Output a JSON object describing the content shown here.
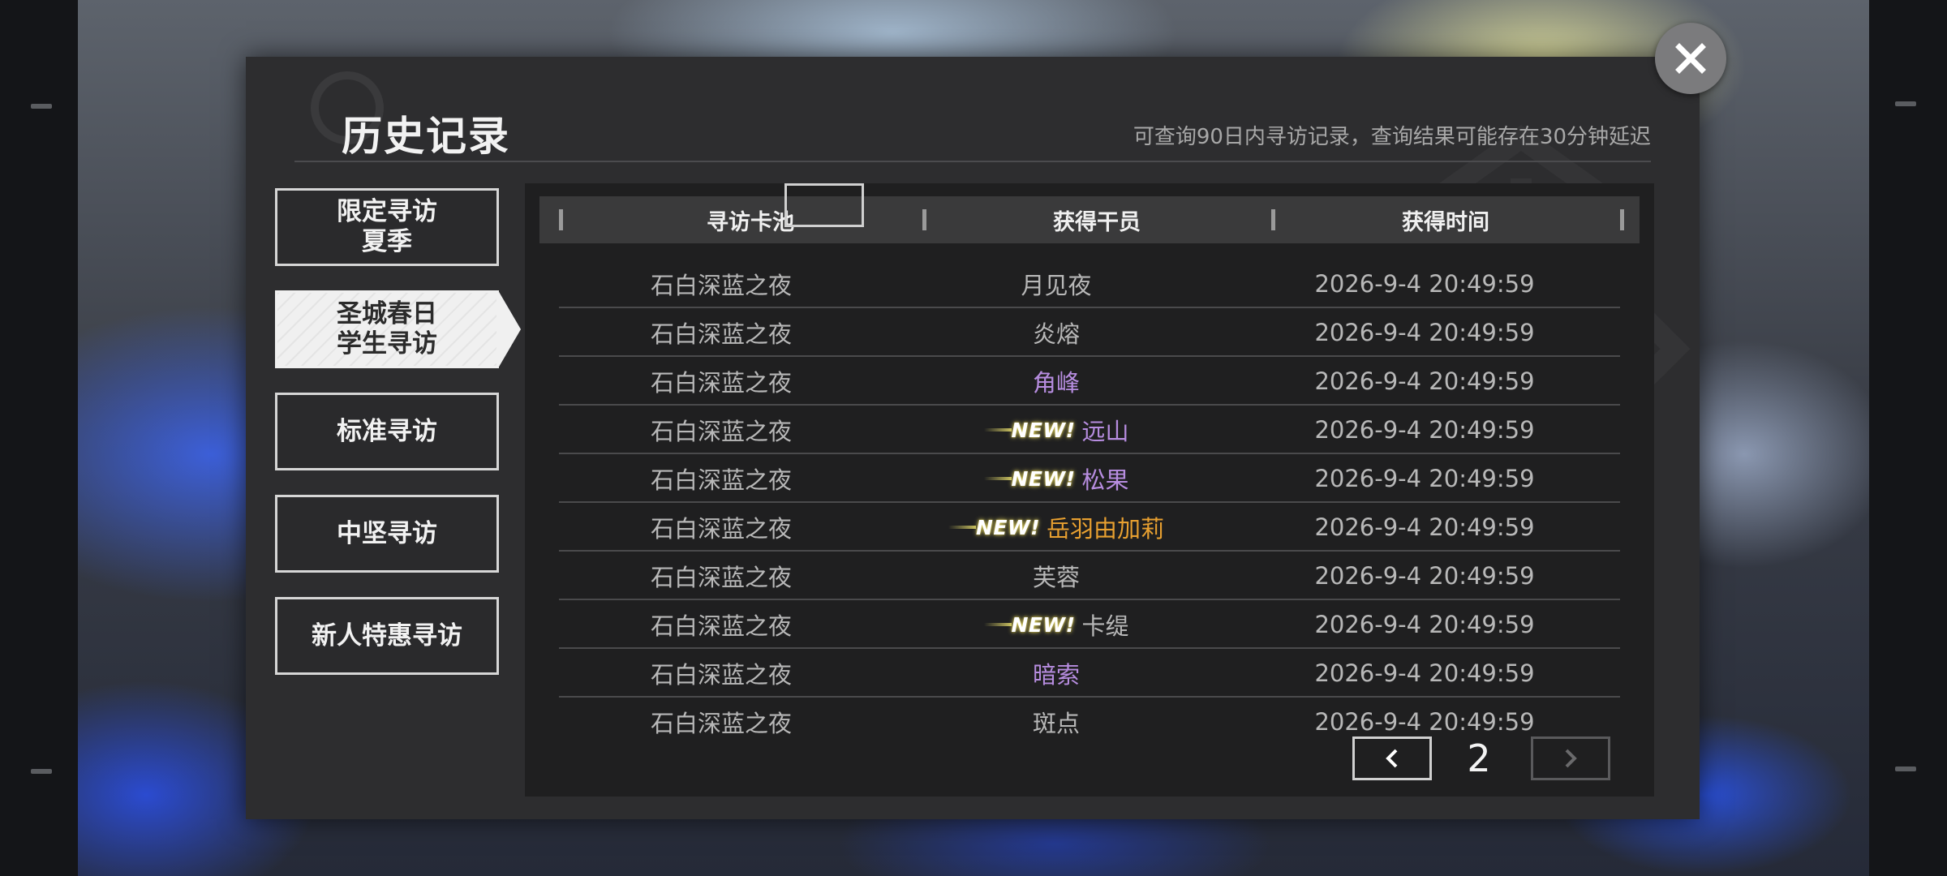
{
  "header": {
    "title": "历史记录",
    "subtitle": "可查询90日内寻访记录，查询结果可能存在30分钟延迟"
  },
  "tabs": [
    {
      "lines": [
        "限定寻访",
        "夏季"
      ],
      "active": false
    },
    {
      "lines": [
        "圣城春日",
        "学生寻访"
      ],
      "active": true
    },
    {
      "lines": [
        "标准寻访"
      ],
      "active": false
    },
    {
      "lines": [
        "中坚寻访"
      ],
      "active": false
    },
    {
      "lines": [
        "新人特惠寻访"
      ],
      "active": false
    }
  ],
  "table": {
    "columns": [
      "寻访卡池",
      "获得干员",
      "获得时间"
    ],
    "rows": [
      {
        "pool": "石白深蓝之夜",
        "operator": "月见夜",
        "time": "2026-9-4 20:49:59",
        "is_new": false,
        "rarity_color": "#b8b8b8"
      },
      {
        "pool": "石白深蓝之夜",
        "operator": "炎熔",
        "time": "2026-9-4 20:49:59",
        "is_new": false,
        "rarity_color": "#b8b8b8"
      },
      {
        "pool": "石白深蓝之夜",
        "operator": "角峰",
        "time": "2026-9-4 20:49:59",
        "is_new": false,
        "rarity_color": "#b78de0"
      },
      {
        "pool": "石白深蓝之夜",
        "operator": "远山",
        "time": "2026-9-4 20:49:59",
        "is_new": true,
        "rarity_color": "#b78de0"
      },
      {
        "pool": "石白深蓝之夜",
        "operator": "松果",
        "time": "2026-9-4 20:49:59",
        "is_new": true,
        "rarity_color": "#b78de0"
      },
      {
        "pool": "石白深蓝之夜",
        "operator": "岳羽由加莉",
        "time": "2026-9-4 20:49:59",
        "is_new": true,
        "rarity_color": "#e8a030"
      },
      {
        "pool": "石白深蓝之夜",
        "operator": "芙蓉",
        "time": "2026-9-4 20:49:59",
        "is_new": false,
        "rarity_color": "#b8b8b8"
      },
      {
        "pool": "石白深蓝之夜",
        "operator": "卡缇",
        "time": "2026-9-4 20:49:59",
        "is_new": true,
        "rarity_color": "#b8b8b8"
      },
      {
        "pool": "石白深蓝之夜",
        "operator": "暗索",
        "time": "2026-9-4 20:49:59",
        "is_new": false,
        "rarity_color": "#b78de0"
      },
      {
        "pool": "石白深蓝之夜",
        "operator": "斑点",
        "time": "2026-9-4 20:49:59",
        "is_new": false,
        "rarity_color": "#b8b8b8"
      }
    ],
    "new_badge_text": "NEW!"
  },
  "pagination": {
    "current_page": "2",
    "prev_icon": "chevron-left-icon",
    "next_icon": "chevron-right-icon",
    "prev_enabled": true,
    "next_enabled": false
  },
  "close": {
    "icon": "close-icon"
  }
}
